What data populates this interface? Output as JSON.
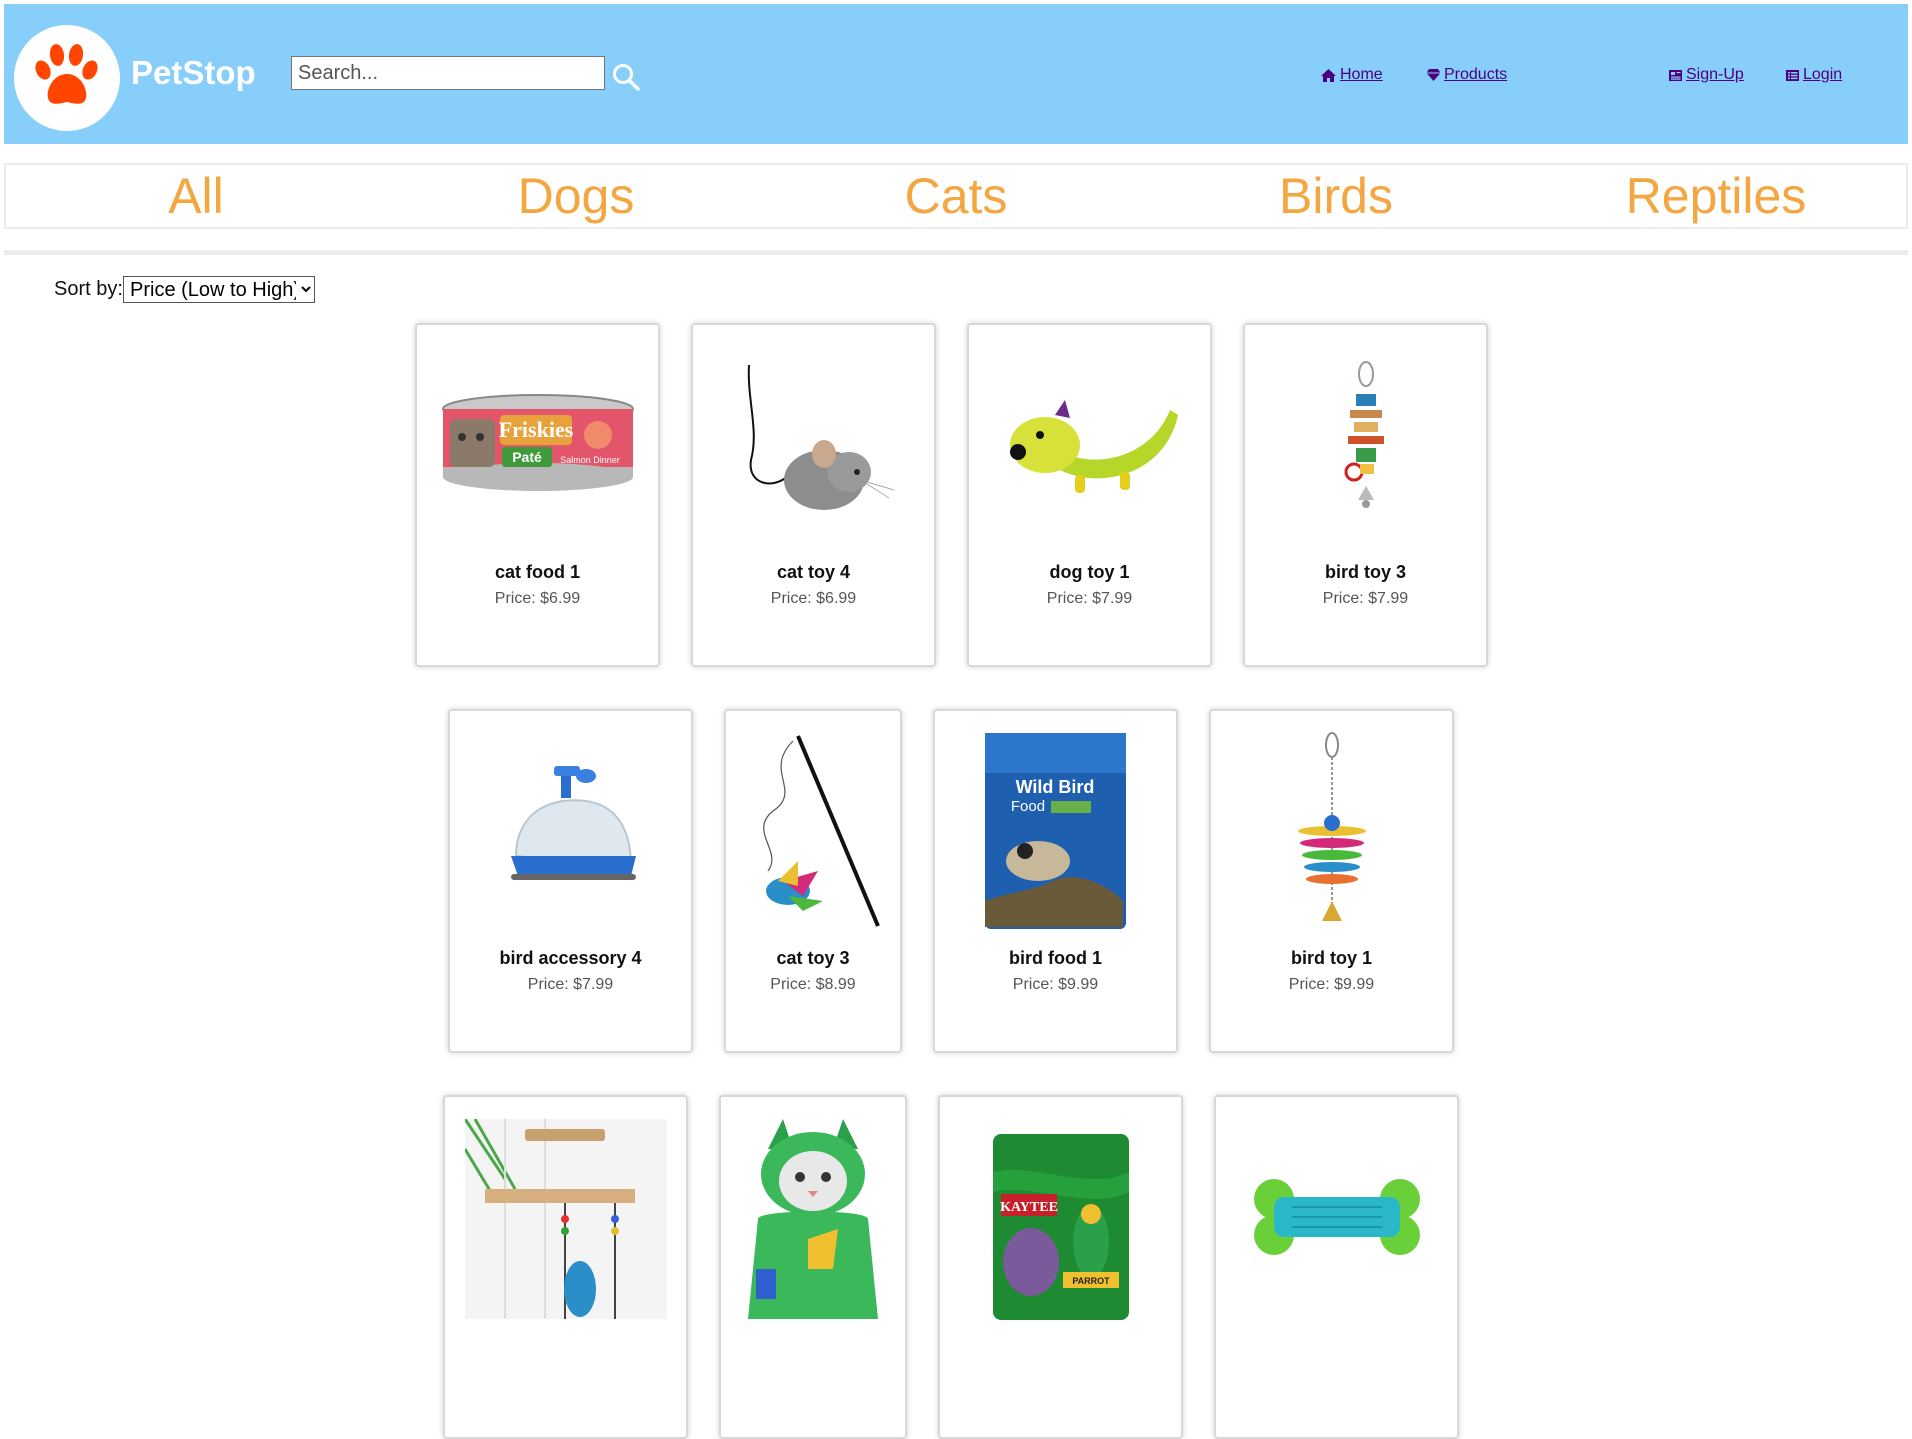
{
  "header": {
    "brand": "PetStop",
    "search_placeholder": "Search...",
    "nav": {
      "home": "Home",
      "products": "Products",
      "signup": "Sign-Up",
      "login": "Login"
    },
    "colors": {
      "header_bg": "#87cefa",
      "paw": "#ff4500",
      "link": "#4b0082"
    }
  },
  "categories": [
    "All",
    "Dogs",
    "Cats",
    "Birds",
    "Reptiles"
  ],
  "sort": {
    "label": "Sort by:",
    "selected": "Price (Low to High)"
  },
  "products": [
    {
      "name": "cat food 1",
      "price": "Price: $6.99",
      "icon": "cat-food-can"
    },
    {
      "name": "cat toy 4",
      "price": "Price: $6.99",
      "icon": "mouse-toy"
    },
    {
      "name": "dog toy 1",
      "price": "Price: $7.99",
      "icon": "banana-dog-toy"
    },
    {
      "name": "bird toy 3",
      "price": "Price: $7.99",
      "icon": "hanging-bird-toy"
    },
    {
      "name": "bird accessory 4",
      "price": "Price: $7.99",
      "icon": "bird-bath"
    },
    {
      "name": "cat toy 3",
      "price": "Price: $8.99",
      "icon": "feather-wand"
    },
    {
      "name": "bird food 1",
      "price": "Price: $9.99",
      "icon": "wild-bird-food-bag"
    },
    {
      "name": "bird toy 1",
      "price": "Price: $9.99",
      "icon": "hanging-bird-toy"
    },
    {
      "name": "",
      "price": "",
      "icon": "bird-perch"
    },
    {
      "name": "",
      "price": "",
      "icon": "cat-costume"
    },
    {
      "name": "",
      "price": "",
      "icon": "parrot-food-bag"
    },
    {
      "name": "",
      "price": "",
      "icon": "bone-chew-toy"
    }
  ],
  "product_image_text": {
    "friskies": "Friskies",
    "pate": "Paté",
    "salmon": "Salmon Dinner",
    "wild_bird_1": "Wild Bird",
    "wild_bird_2": "Food",
    "kaytee": "KAYTEE",
    "parrot": "PARROT"
  }
}
